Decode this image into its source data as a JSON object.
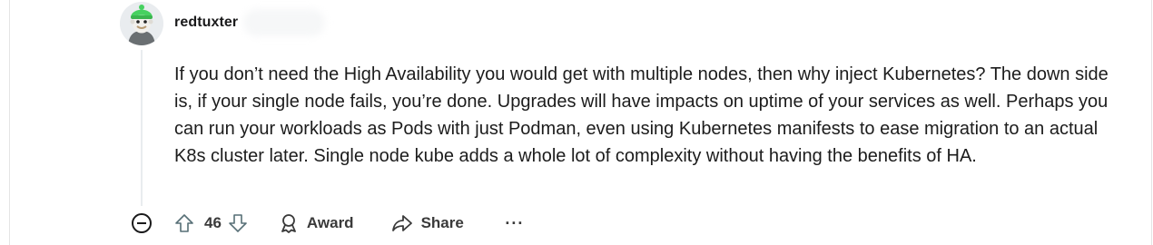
{
  "comment": {
    "username": "redtuxter",
    "body": "If you don’t need the High Availability you would get with multiple nodes, then why inject Kubernetes? The down side is, if your single node fails, you’re done. Upgrades will have impacts on uptime of your services as well. Perhaps you can run your workloads as Pods with just Podman, even using Kubernetes manifests to ease migration to an actual K8s cluster later. Single node kube adds a whole lot of complexity without having the benefits of HA."
  },
  "actions": {
    "collapse_icon": "minus-circle-icon",
    "upvote_icon": "arrow-up-icon",
    "vote_count": "46",
    "downvote_icon": "arrow-down-icon",
    "award_icon": "award-icon",
    "award_label": "Award",
    "share_icon": "share-icon",
    "share_label": "Share",
    "more_label": "···"
  },
  "colors": {
    "avatar_accent": "#46d160",
    "text": "#1c1c1c",
    "icon": "#576f76"
  }
}
